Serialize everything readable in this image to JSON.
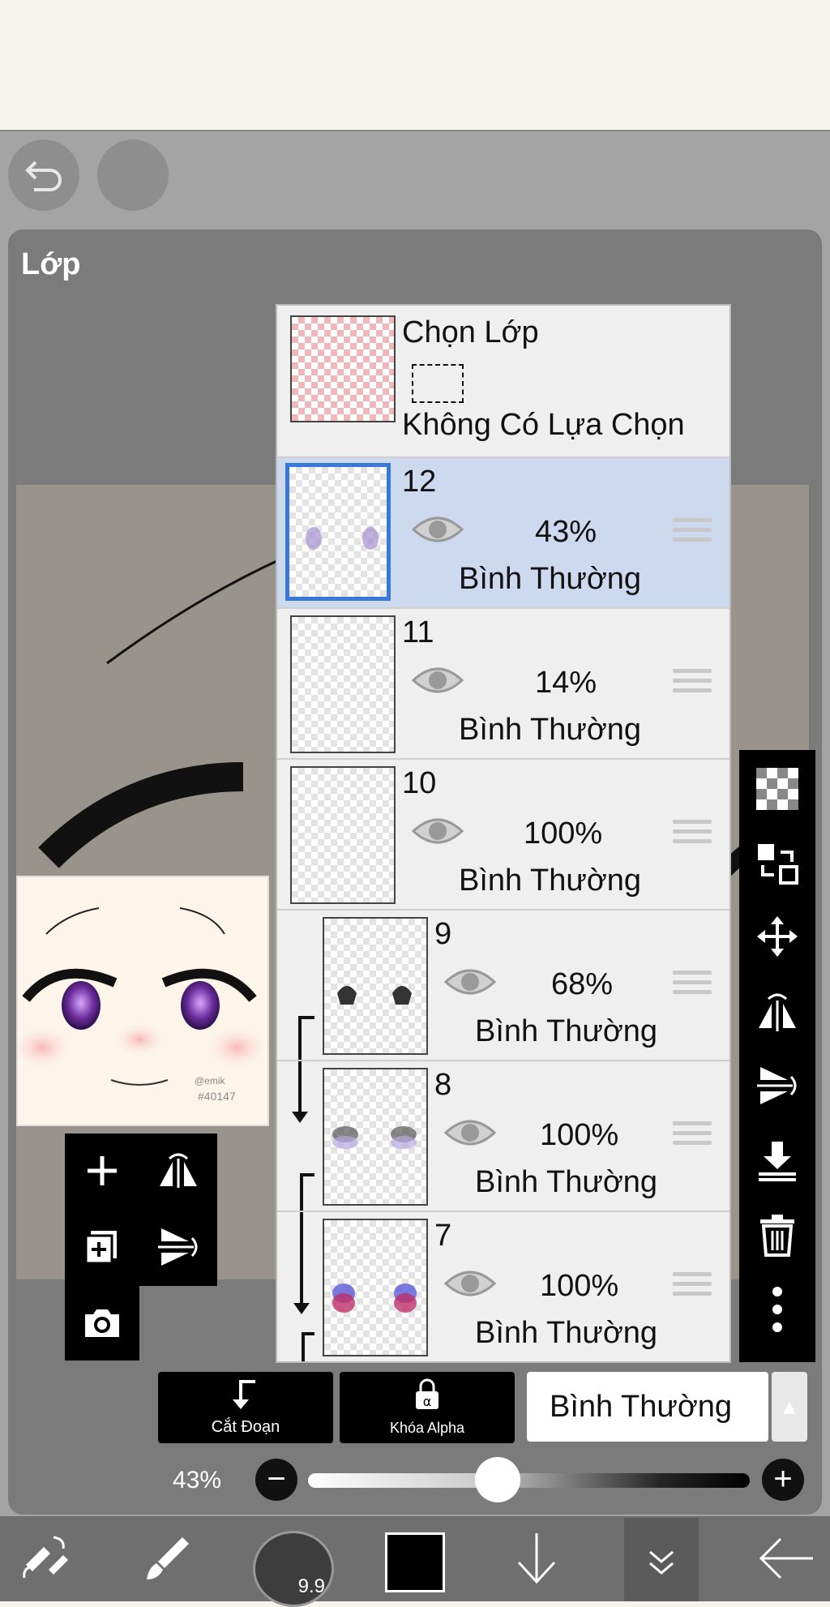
{
  "toolbar": {
    "undo_icon": "undo-icon",
    "redo_icon": "redo-icon"
  },
  "panel": {
    "title": "Lớp"
  },
  "selection_layer": {
    "title": "Chọn Lớp",
    "status": "Không Có Lựa Chọn"
  },
  "layers": [
    {
      "number": "12",
      "opacity": "43%",
      "blend": "Bình Thường",
      "selected": true
    },
    {
      "number": "11",
      "opacity": "14%",
      "blend": "Bình Thường",
      "selected": false
    },
    {
      "number": "10",
      "opacity": "100%",
      "blend": "Bình Thường",
      "selected": false
    },
    {
      "number": "9",
      "opacity": "68%",
      "blend": "Bình Thường",
      "selected": false,
      "clipped": true
    },
    {
      "number": "8",
      "opacity": "100%",
      "blend": "Bình Thường",
      "selected": false,
      "clipped": true
    },
    {
      "number": "7",
      "opacity": "100%",
      "blend": "Bình Thường",
      "selected": false,
      "clipped": true
    }
  ],
  "layer_actions": {
    "clip_label": "Cắt Đoạn",
    "alpha_lock_label": "Khóa Alpha",
    "blend_mode": "Bình Thường"
  },
  "opacity": {
    "value_label": "43%",
    "value": 0.43
  },
  "preview": {
    "watermark": "@emik\n#40147"
  },
  "bottom_nav": {
    "brush_size": "9.9"
  },
  "colors": {
    "selected_row": "#cdd9ee",
    "selected_border": "#3a78d8",
    "current_color": "#000000"
  }
}
